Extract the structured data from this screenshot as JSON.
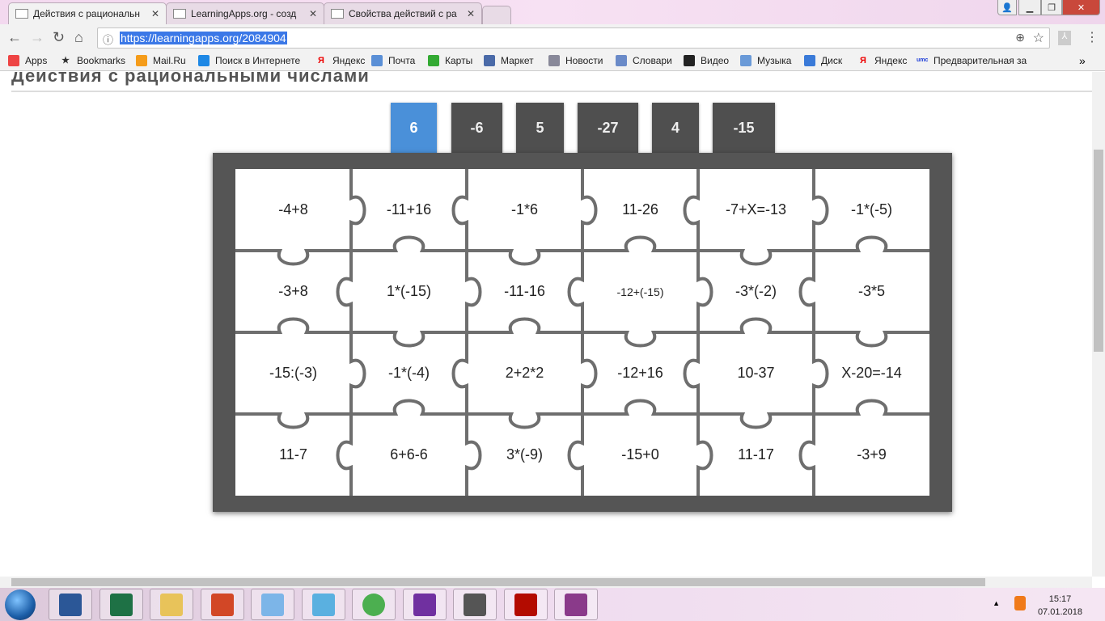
{
  "browser": {
    "tabs": [
      {
        "label": "Действия с рациональн",
        "active": true
      },
      {
        "label": "LearningApps.org - созд",
        "active": false
      },
      {
        "label": "Свойства действий с ра",
        "active": false
      }
    ],
    "url": "https://learningapps.org/2084904",
    "bookmarks": [
      {
        "label": "Apps",
        "icon": "apps-grid-icon"
      },
      {
        "label": "Bookmarks",
        "icon": "star-icon"
      },
      {
        "label": "Mail.Ru",
        "icon": "mailru-icon"
      },
      {
        "label": "Поиск в Интернете",
        "icon": "search-icon"
      },
      {
        "label": "Яндекс",
        "icon": "yandex-icon"
      },
      {
        "label": "Почта",
        "icon": "mail-icon"
      },
      {
        "label": "Карты",
        "icon": "maps-icon"
      },
      {
        "label": "Маркет",
        "icon": "market-icon"
      },
      {
        "label": "Новости",
        "icon": "news-icon"
      },
      {
        "label": "Словари",
        "icon": "dictionary-icon"
      },
      {
        "label": "Видео",
        "icon": "video-icon"
      },
      {
        "label": "Музыка",
        "icon": "music-icon"
      },
      {
        "label": "Диск",
        "icon": "disk-icon"
      },
      {
        "label": "Яндекс",
        "icon": "yandex-icon"
      },
      {
        "label": "Предварительная за",
        "icon": "umc-icon"
      }
    ],
    "more": "»"
  },
  "page": {
    "title": "Действия с рациональными числами",
    "answers": [
      "6",
      "-6",
      "5",
      "-27",
      "4",
      "-15"
    ],
    "selected_answer": 0,
    "accent": "#4a90d9",
    "pieces": [
      [
        "-4+8",
        "-11+16",
        "-1*6",
        "11-26",
        "-7+X=-13",
        "-1*(-5)"
      ],
      [
        "-3+8",
        "1*(-15)",
        "-11-16",
        "-12+(-15)",
        "-3*(-2)",
        "-3*5"
      ],
      [
        "-15:(-3)",
        "-1*(-4)",
        "2+2*2",
        "-12+16",
        "10-37",
        "X-20=-14"
      ],
      [
        "11-7",
        "6+6-6",
        "3*(-9)",
        "-15+0",
        "11-17",
        "-3+9"
      ]
    ]
  },
  "taskbar": {
    "apps": [
      "word",
      "excel",
      "explorer",
      "powerpoint",
      "paint",
      "calculator",
      "chrome",
      "onenote",
      "webcam",
      "acrobat",
      "winrar"
    ],
    "time": "15:17",
    "date": "07.01.2018"
  }
}
